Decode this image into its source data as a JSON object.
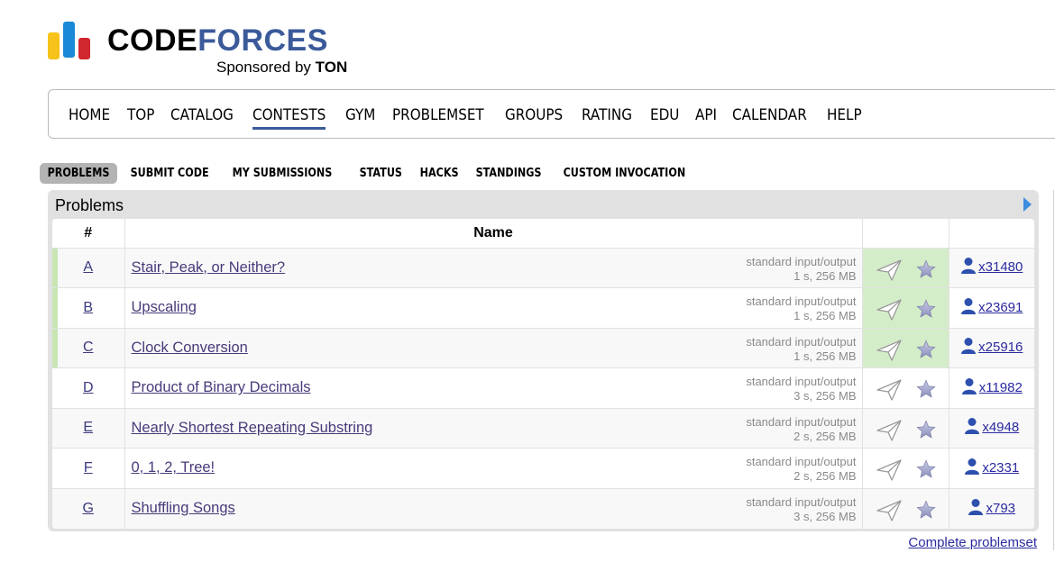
{
  "logo": {
    "word_part1": "CODE",
    "word_part2": "FORCES",
    "sponsor_prefix": "Sponsored by ",
    "sponsor_name": "TON"
  },
  "main_menu": {
    "items": [
      {
        "label": "HOME",
        "active": false
      },
      {
        "label": "TOP",
        "active": false
      },
      {
        "label": "CATALOG",
        "active": false
      },
      {
        "label": "CONTESTS",
        "active": true
      },
      {
        "label": "GYM",
        "active": false
      },
      {
        "label": "PROBLEMSET",
        "active": false
      },
      {
        "label": "GROUPS",
        "active": false
      },
      {
        "label": "RATING",
        "active": false
      },
      {
        "label": "EDU",
        "active": false
      },
      {
        "label": "API",
        "active": false
      },
      {
        "label": "CALENDAR",
        "active": false
      },
      {
        "label": "HELP",
        "active": false
      }
    ]
  },
  "sub_menu": {
    "items": [
      {
        "label": "PROBLEMS",
        "active": true
      },
      {
        "label": "SUBMIT CODE",
        "active": false
      },
      {
        "label": "MY SUBMISSIONS",
        "active": false
      },
      {
        "label": "STATUS",
        "active": false
      },
      {
        "label": "HACKS",
        "active": false
      },
      {
        "label": "STANDINGS",
        "active": false
      },
      {
        "label": "CUSTOM INVOCATION",
        "active": false
      }
    ]
  },
  "problems": {
    "title": "Problems",
    "columns": {
      "index": "#",
      "name": "Name"
    },
    "rows": [
      {
        "index": "A",
        "name": "Stair, Peak, or Neither?",
        "io": "standard input/output",
        "limits": "1 s, 256 MB",
        "solved": "x31480",
        "accepted": true
      },
      {
        "index": "B",
        "name": "Upscaling",
        "io": "standard input/output",
        "limits": "1 s, 256 MB",
        "solved": "x23691",
        "accepted": true
      },
      {
        "index": "C",
        "name": "Clock Conversion",
        "io": "standard input/output",
        "limits": "1 s, 256 MB",
        "solved": "x25916",
        "accepted": true
      },
      {
        "index": "D",
        "name": "Product of Binary Decimals",
        "io": "standard input/output",
        "limits": "3 s, 256 MB",
        "solved": "x11982",
        "accepted": false
      },
      {
        "index": "E",
        "name": "Nearly Shortest Repeating Substring",
        "io": "standard input/output",
        "limits": "2 s, 256 MB",
        "solved": "x4948",
        "accepted": false
      },
      {
        "index": "F",
        "name": "0, 1, 2, Tree!",
        "io": "standard input/output",
        "limits": "2 s, 256 MB",
        "solved": "x2331",
        "accepted": false
      },
      {
        "index": "G",
        "name": "Shuffling Songs",
        "io": "standard input/output",
        "limits": "3 s, 256 MB",
        "solved": "x793",
        "accepted": false
      }
    ],
    "complete_link": "Complete problemset"
  },
  "colors": {
    "brand_blue": "#3b5a9a",
    "accepted_green": "#d4edc9",
    "link": "#2a2aa0"
  }
}
